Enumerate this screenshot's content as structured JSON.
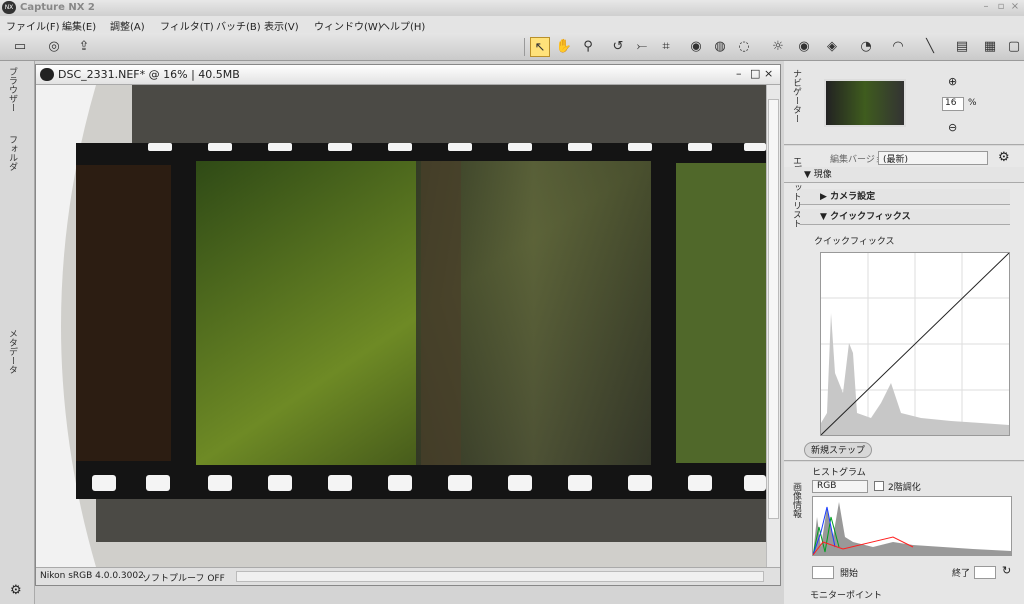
{
  "window": {
    "title": "Capture NX 2"
  },
  "menu": [
    "ファイル(F)",
    "編集(E)",
    "調整(A)",
    "フィルタ(T)",
    "バッチ(B)",
    "表示(V)",
    "ウィンドウ(W)",
    "ヘルプ(H)"
  ],
  "left_tabs": {
    "browser": "ブラウザー",
    "folder": "フォルダ",
    "metadata": "メタデータ"
  },
  "document": {
    "title": "DSC_2331.NEF* @ 16% | 40.5MB"
  },
  "statusbar": {
    "profile": "Nikon sRGB 4.0.0.3002",
    "softproof": "ソフトプルーフ OFF"
  },
  "navigator": {
    "tab": "ナビゲーター",
    "zoom_value": "16",
    "zoom_unit": "%"
  },
  "editlist": {
    "tab": "エディットリスト",
    "version_label": "編集バージョン",
    "version_value": "(最新)",
    "current": "現像",
    "camera_settings": "カメラ設定",
    "quickfix_header": "クイックフィックス",
    "quickfix_item": "クイックフィックス",
    "new_step": "新規ステップ"
  },
  "photoinfo": {
    "tab": "画像情報",
    "histogram": "ヒストグラム",
    "channel": "RGB",
    "two_tone": "2階調化",
    "start_label": "開始",
    "end_label": "終了",
    "monitor_point": "モニターポイント"
  }
}
